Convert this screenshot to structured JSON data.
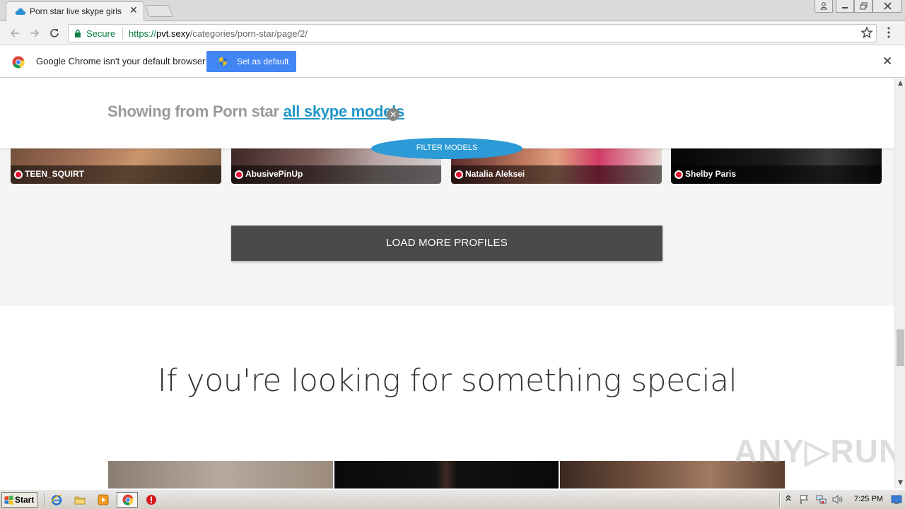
{
  "browser": {
    "tab_title": "Porn star live skype girls",
    "tab_close": "✕",
    "secure_label": "Secure",
    "url_scheme": "https://",
    "url_host": "pvt.sexy",
    "url_path": "/categories/porn-star/page/2/"
  },
  "infobar": {
    "message": "Google Chrome isn't your default browser",
    "button_label": "Set as default",
    "close": "✕"
  },
  "page": {
    "filter_prefix": "Showing from Porn star ",
    "filter_link": "all skype models",
    "filter_clear": "✕",
    "filter_button": "FILTER MODELS",
    "models": [
      {
        "name": "TEEN_SQUIRT"
      },
      {
        "name": "AbusivePinUp"
      },
      {
        "name": "Natalia Aleksei"
      },
      {
        "name": "Shelby Paris"
      }
    ],
    "load_more": "LOAD MORE PROFILES",
    "special_heading": "If you're looking for something special",
    "watermark": "ANY▷RUN"
  },
  "taskbar": {
    "start_label": "Start",
    "clock": "7:25 PM"
  },
  "colors": {
    "accent_link": "#2196c8",
    "filter_pill": "#2b9ad6",
    "chrome_blue_button": "#4285f4",
    "secure_green": "#0b8043",
    "live_dot": "#e0102f"
  }
}
